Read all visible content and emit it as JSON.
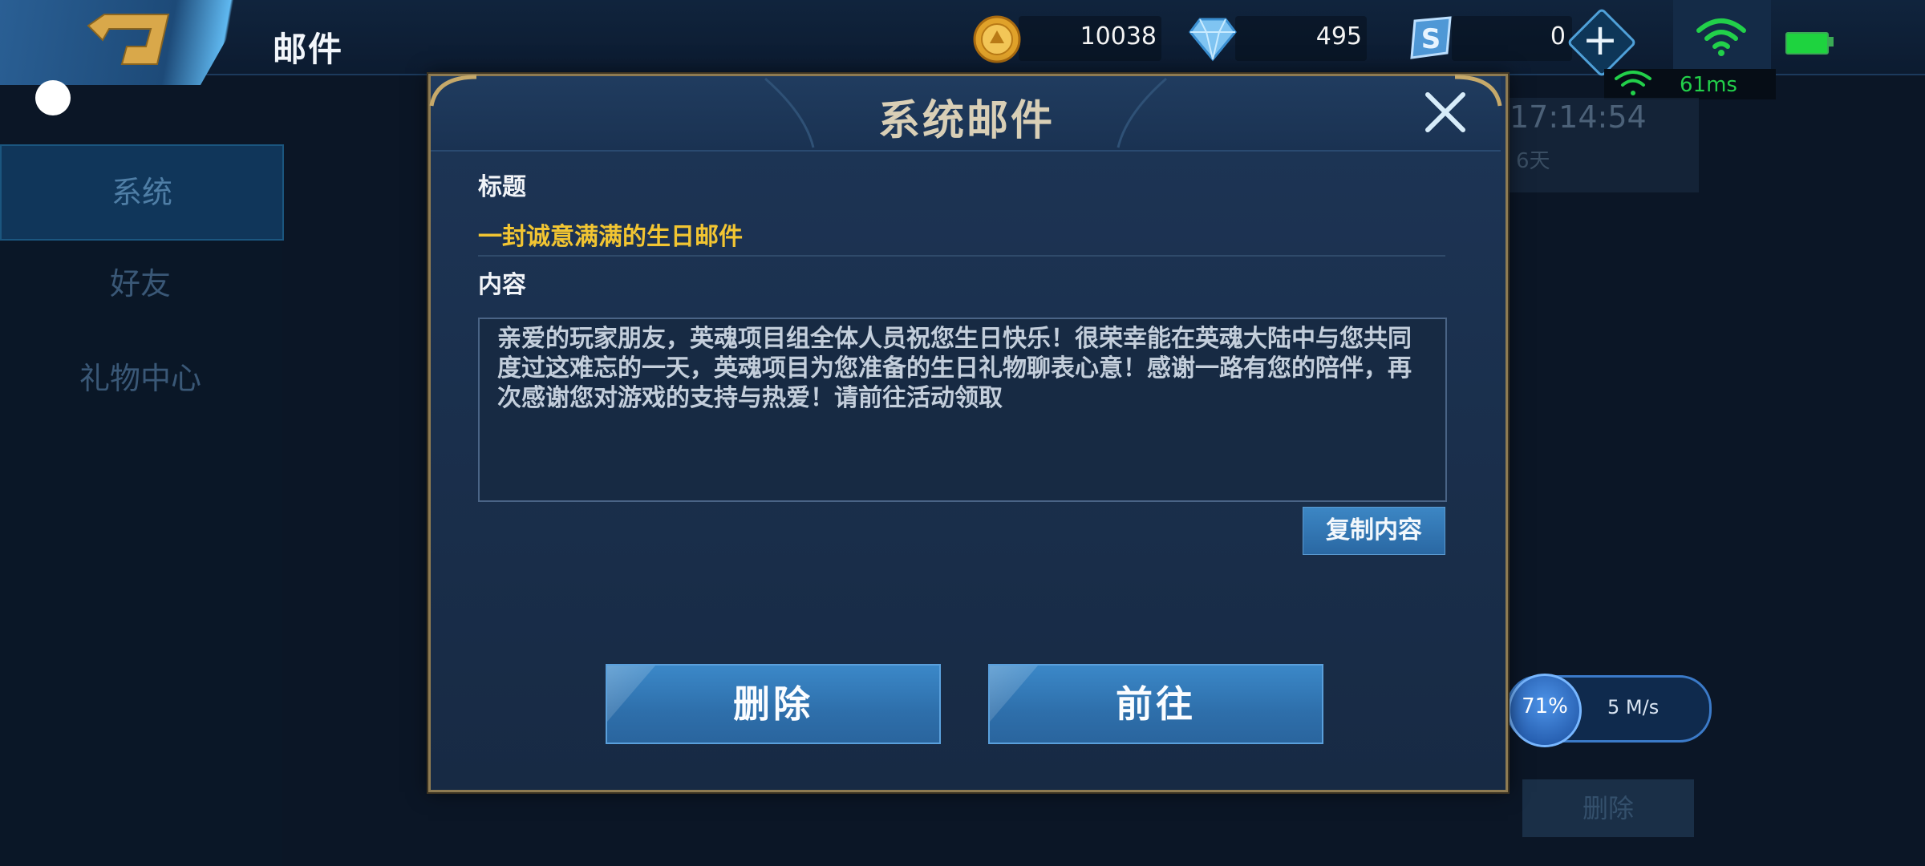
{
  "header": {
    "title": "邮件",
    "currencies": [
      {
        "name": "gold-coin",
        "value": "10038",
        "color": "#e0a22a"
      },
      {
        "name": "diamond",
        "value": "495",
        "color": "#7fc4f2"
      },
      {
        "name": "s-token",
        "value": "0",
        "color": "#4f98d6"
      }
    ],
    "ping": "61ms",
    "accent_color": "#22d04a"
  },
  "sidebar": {
    "items": [
      {
        "label": "系统",
        "selected": true
      },
      {
        "label": "好友",
        "selected": false
      },
      {
        "label": "礼物中心",
        "selected": false
      }
    ]
  },
  "background": {
    "time": "17:14:54",
    "days": "6天",
    "delete_label": "删除",
    "download": {
      "percent": "71%",
      "rate": "5 M/s"
    }
  },
  "modal": {
    "title": "系统邮件",
    "label_title": "标题",
    "subject": "一封诚意满满的生日邮件",
    "label_content": "内容",
    "content": "亲爱的玩家朋友，英魂项目组全体人员祝您生日快乐！很荣幸能在英魂大陆中与您共同度过这难忘的一天，英魂项目为您准备的生日礼物聊表心意！感谢一路有您的陪伴，再次感谢您对游戏的支持与热爱！请前往活动领取",
    "copy_label": "复制内容",
    "delete_label": "删除",
    "goto_label": "前往",
    "subject_color": "#f2c532"
  }
}
